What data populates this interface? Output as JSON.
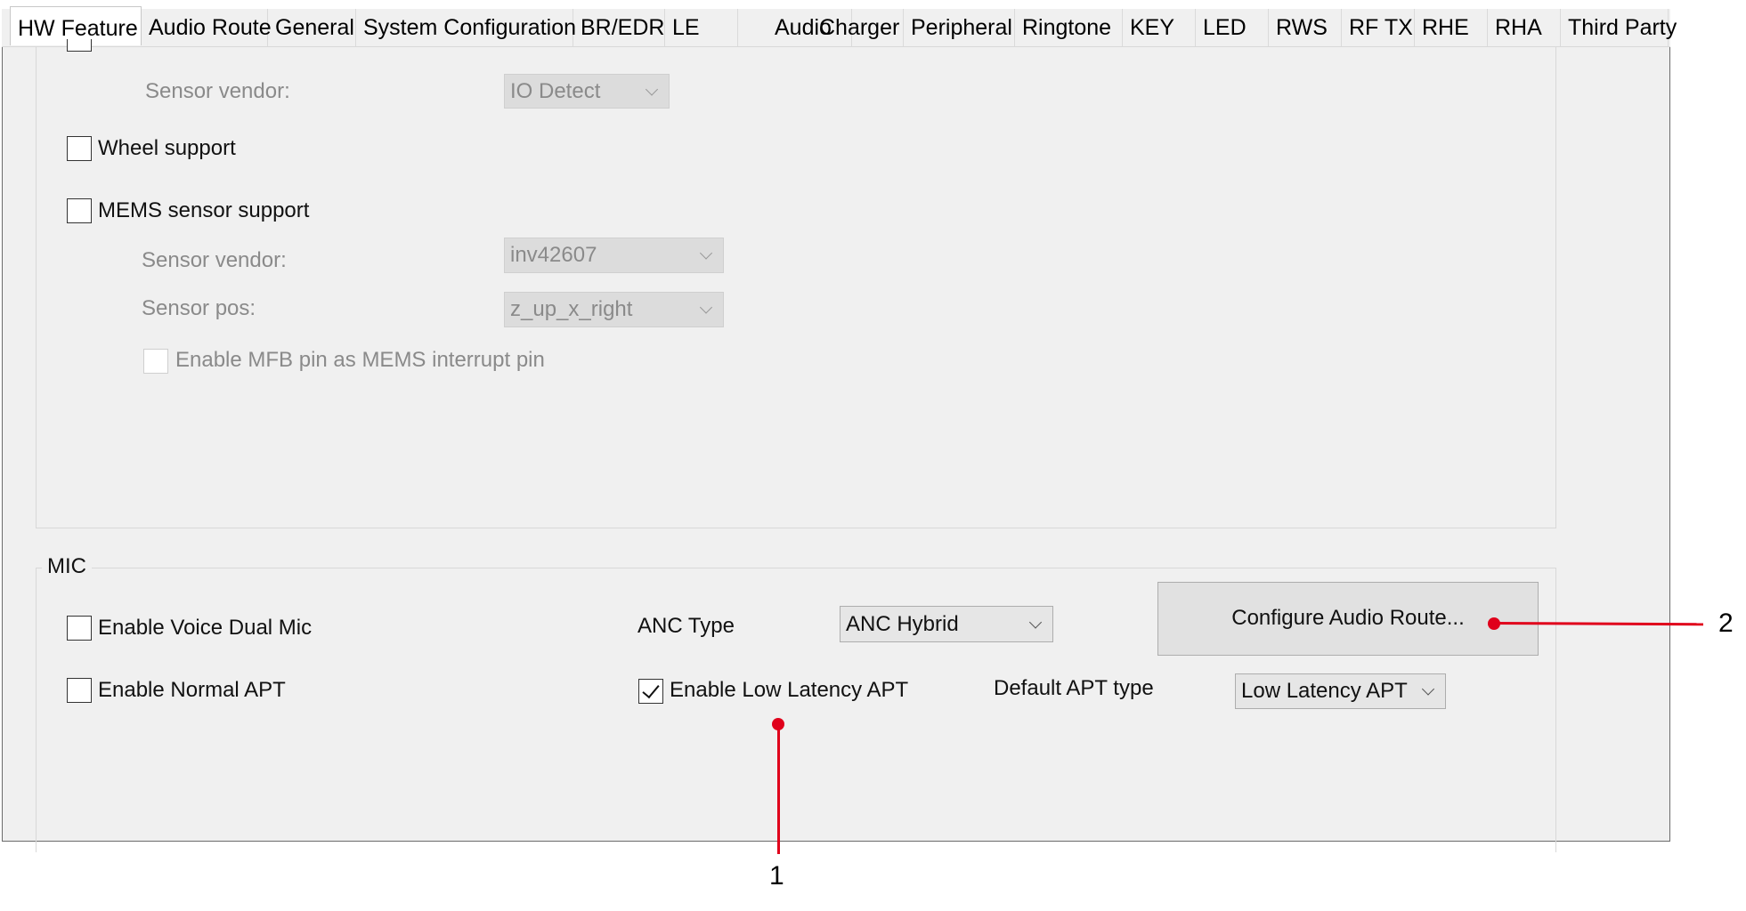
{
  "tabs": [
    {
      "label": "HW Feature",
      "active": true
    },
    {
      "label": "Audio Route"
    },
    {
      "label": "General"
    },
    {
      "label": "System Configuration"
    },
    {
      "label": "BR/EDR"
    },
    {
      "label": "LE"
    },
    {
      "label": "Audio"
    },
    {
      "label": "Charger"
    },
    {
      "label": "Peripheral"
    },
    {
      "label": "Ringtone"
    },
    {
      "label": "KEY"
    },
    {
      "label": "LED"
    },
    {
      "label": "RWS"
    },
    {
      "label": "RF TX"
    },
    {
      "label": "RHE"
    },
    {
      "label": "RHA"
    },
    {
      "label": "Third Party"
    }
  ],
  "sensor_section": {
    "top_sensor_vendor_label": "Sensor vendor:",
    "top_sensor_vendor_value": "IO Detect",
    "wheel_support_label": "Wheel support",
    "mems_support_label": "MEMS sensor support",
    "mems_vendor_label": "Sensor vendor:",
    "mems_vendor_value": "inv42607",
    "mems_pos_label": "Sensor pos:",
    "mems_pos_value": "z_up_x_right",
    "mfb_interrupt_label": "Enable MFB pin as MEMS interrupt pin"
  },
  "mic": {
    "title": "MIC",
    "voice_dual_mic_label": "Enable Voice Dual Mic",
    "normal_apt_label": "Enable Normal APT",
    "anc_type_label": "ANC Type",
    "anc_type_value": "ANC Hybrid",
    "low_latency_apt_label": "Enable Low Latency APT",
    "low_latency_apt_checked": true,
    "default_apt_label": "Default APT type",
    "default_apt_value": "Low Latency APT",
    "configure_button_label": "Configure Audio Route..."
  },
  "annotations": {
    "callout_1": "1",
    "callout_2": "2",
    "color": "#e0001b"
  }
}
